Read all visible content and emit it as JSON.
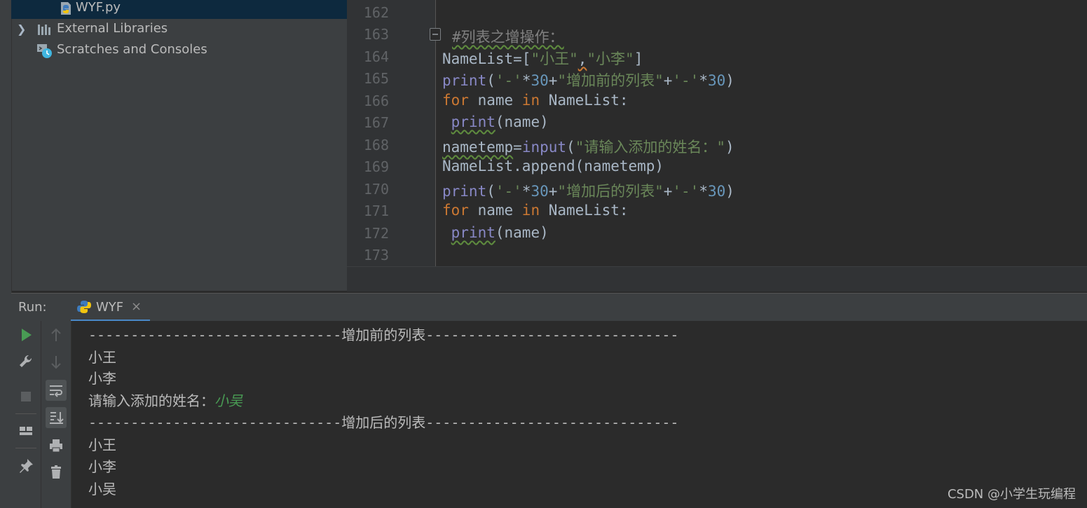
{
  "project_tree": {
    "items": [
      {
        "label": "WYF.py",
        "selected": true,
        "icon": "python-file-icon"
      },
      {
        "label": "External Libraries",
        "selected": false,
        "icon": "libraries-icon"
      },
      {
        "label": "Scratches and Consoles",
        "selected": false,
        "icon": "scratches-icon"
      }
    ]
  },
  "editor": {
    "line_numbers": [
      "162",
      "163",
      "164",
      "165",
      "166",
      "167",
      "168",
      "169",
      "170",
      "171",
      "172",
      "173"
    ]
  },
  "run_panel": {
    "label": "Run:",
    "tab_name": "WYF",
    "close_glyph": "×"
  },
  "console": {
    "lines": [
      "------------------------------增加前的列表------------------------------",
      "小王",
      "小李",
      "请输入添加的姓名：",
      "------------------------------增加后的列表------------------------------",
      "小王",
      "小李",
      "小吴"
    ],
    "user_input": "小吴"
  },
  "watermark": "CSDN @小学生玩编程",
  "colors": {
    "keyword": "#cc7832",
    "builtin": "#8888c6",
    "string": "#6a8759",
    "number": "#6897bb",
    "comment": "#808080",
    "user_input": "#499c54",
    "tab_accent": "#4a88c7"
  }
}
